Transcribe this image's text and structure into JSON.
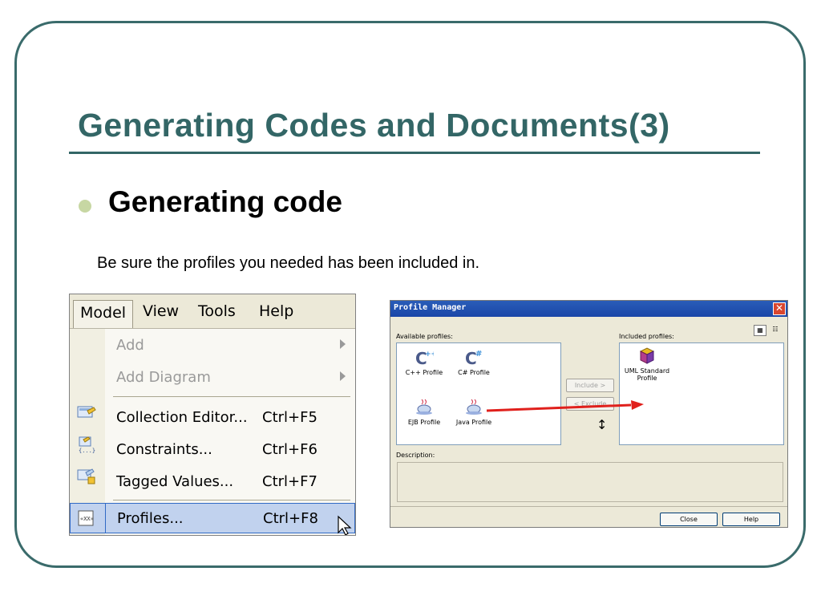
{
  "slide": {
    "title": "Generating Codes and Documents(3)",
    "bullet": "Generating code",
    "subtext": "Be sure the profiles you needed has been included in."
  },
  "menu": {
    "bar": [
      "Model",
      "View",
      "Tools",
      "Help"
    ],
    "items": [
      {
        "label": "Add",
        "shortcut": "",
        "disabled": true,
        "submenu": true
      },
      {
        "label": "Add Diagram",
        "shortcut": "",
        "disabled": true,
        "submenu": true
      },
      {
        "label": "Collection Editor...",
        "shortcut": "Ctrl+F5",
        "icon": "collection-editor-icon"
      },
      {
        "label": "Constraints...",
        "shortcut": "Ctrl+F6",
        "icon": "constraints-icon"
      },
      {
        "label": "Tagged Values...",
        "shortcut": "Ctrl+F7",
        "icon": "tagged-values-icon"
      },
      {
        "label": "Profiles...",
        "shortcut": "Ctrl+F8",
        "icon": "profiles-icon",
        "selected": true
      }
    ]
  },
  "profile_manager": {
    "title": "Profile Manager",
    "close_glyph": "✕",
    "available_label": "Available profiles:",
    "included_label": "Included profiles:",
    "available": [
      "C++ Profile",
      "C# Profile",
      "EJB Profile",
      "Java Profile"
    ],
    "included": [
      "UML Standard Profile"
    ],
    "include_button": "Include >",
    "exclude_button": "< Exclude",
    "description_label": "Description:",
    "close_button": "Close",
    "help_button": "Help",
    "arrow_color": "#e0201c"
  }
}
